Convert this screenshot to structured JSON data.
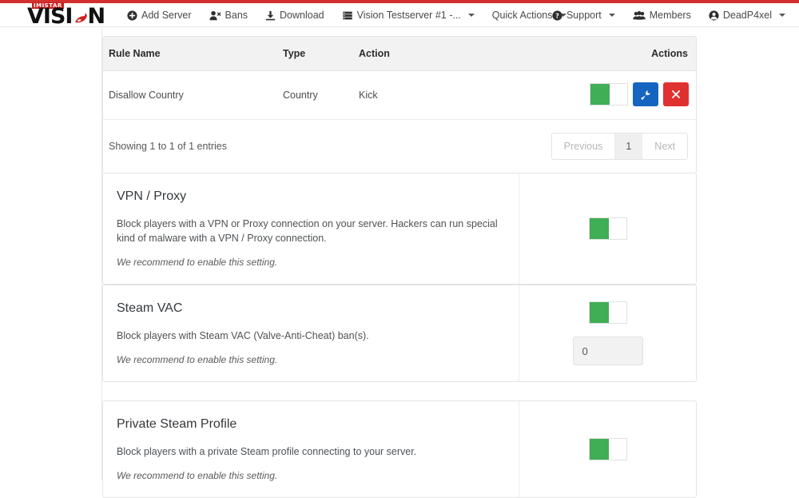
{
  "theme": {
    "accent_red": "#d32f2f",
    "toggle_on_green": "#3fae55",
    "edit_blue": "#1565c0",
    "delete_red": "#e03131"
  },
  "brand": {
    "sup": "IMISTAR",
    "word": "VISI",
    "word_tail": "N",
    "chili_icon": "chili-pepper-icon"
  },
  "navbar": {
    "left_items": [
      {
        "label": "Add Server",
        "icon": "plus-circle-icon",
        "caret": false
      },
      {
        "label": "Bans",
        "icon": "user-times-icon",
        "caret": false
      },
      {
        "label": "Download",
        "icon": "download-icon",
        "caret": false
      },
      {
        "label": "Vision Testserver #1 -...",
        "icon": "server-icon",
        "caret": true
      },
      {
        "label": "Quick Actions",
        "icon": "",
        "caret": true
      }
    ],
    "right_items": [
      {
        "label": "Support",
        "icon": "question-circle-icon",
        "caret": true
      },
      {
        "label": "Members",
        "icon": "users-icon",
        "caret": false
      },
      {
        "label": "DeadP4xel",
        "icon": "user-circle-icon",
        "caret": true
      }
    ]
  },
  "rules_table": {
    "columns": [
      "Rule Name",
      "Type",
      "Action",
      "Actions"
    ],
    "rows": [
      {
        "rule_name": "Disallow Country",
        "type": "Country",
        "action": "Kick",
        "enabled": true,
        "edit_icon": "wrench-icon",
        "delete_icon": "close-x-icon"
      }
    ],
    "footer": {
      "showing": "Showing 1 to 1 of 1 entries",
      "pager": {
        "previous": "Previous",
        "pages": [
          "1"
        ],
        "current_page": "1",
        "next": "Next"
      }
    }
  },
  "settings": [
    {
      "title": "VPN / Proxy",
      "description": "Block players with a VPN or Proxy connection on your server. Hackers can run special kind of malware with a VPN / Proxy connection.",
      "recommendation": "We recommend to enable this setting.",
      "enabled": true,
      "has_input": false,
      "input_value": ""
    },
    {
      "title": "Steam VAC",
      "description": "Block players with Steam VAC (Valve-Anti-Cheat) ban(s).",
      "recommendation": "We recommend to enable this setting.",
      "enabled": true,
      "has_input": true,
      "input_value": "0"
    },
    {
      "title": "Private Steam Profile",
      "description": "Block players with a private Steam profile connecting to your server.",
      "recommendation": "We recommend to enable this setting.",
      "enabled": true,
      "has_input": false,
      "input_value": ""
    }
  ]
}
